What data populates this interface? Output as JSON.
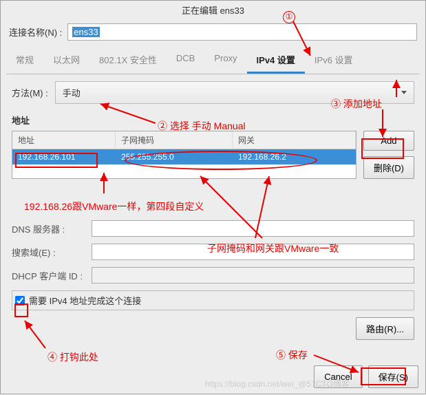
{
  "title": "正在编辑 ens33",
  "conn_label": "连接名称(N) :",
  "conn_value": "ens33",
  "tabs": [
    "常规",
    "以太网",
    "802.1X 安全性",
    "DCB",
    "Proxy",
    "IPv4 设置",
    "IPv6 设置"
  ],
  "method_label": "方法(M) :",
  "method_value": "手动",
  "addr_title": "地址",
  "table": {
    "headers": [
      "地址",
      "子网掩码",
      "网关"
    ],
    "row": [
      "192.168.26.101",
      "255.255.255.0",
      "192.168.26.2"
    ]
  },
  "buttons": {
    "add": "Add",
    "delete": "删除(D)",
    "routes": "路由(R)...",
    "cancel": "Cancel",
    "save": "保存(S)"
  },
  "fields": {
    "dns": "DNS 服务器 :",
    "search": "搜索域(E) :",
    "dhcp": "DHCP 客户端 ID :"
  },
  "checkbox_label": "需要 IPv4 地址完成这个连接",
  "anno": {
    "a1": "①",
    "a2_sel": "② 选择 手动 Manual",
    "a3": "③ 添加地址",
    "a4_ip": "192.168.26跟VMware一样，第四段自定义",
    "a4_mask": "子网掩码和网关跟VMware一致",
    "a4_chk": "④ 打钩此处",
    "a5": "⑤ 保存"
  },
  "watermark": "https://blog.csdn.net/wei_@51CTO博客"
}
